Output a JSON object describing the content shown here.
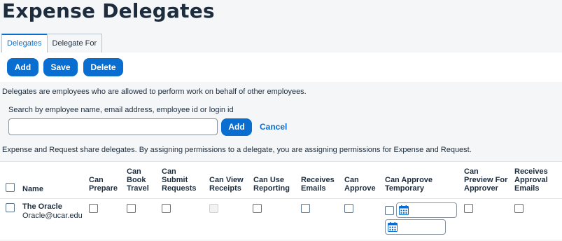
{
  "page": {
    "title": "Expense Delegates"
  },
  "tabs": [
    {
      "label": "Delegates",
      "active": true
    },
    {
      "label": "Delegate For",
      "active": false
    }
  ],
  "toolbar": {
    "add_label": "Add",
    "save_label": "Save",
    "delete_label": "Delete"
  },
  "info_text": "Delegates are employees who are allowed to perform work on behalf of other employees.",
  "search": {
    "label": "Search by employee name, email address, employee id or login id",
    "value": "",
    "add_label": "Add",
    "cancel_label": "Cancel"
  },
  "share_note": "Expense and Request share delegates. By assigning permissions to a delegate, you are assigning permissions for Expense and Request.",
  "table": {
    "headers": {
      "name": "Name",
      "can_prepare": [
        "Can",
        "Prepare"
      ],
      "can_book_travel": [
        "Can",
        "Book",
        "Travel"
      ],
      "can_submit_requests": [
        "Can",
        "Submit",
        "Requests"
      ],
      "can_view_receipts": [
        "Can View",
        "Receipts"
      ],
      "can_use_reporting": [
        "Can Use",
        "Reporting"
      ],
      "receives_emails": [
        "Receives",
        "Emails"
      ],
      "can_approve": [
        "Can",
        "Approve"
      ],
      "can_approve_temporary": [
        "Can Approve",
        "Temporary"
      ],
      "can_preview_for_approver": [
        "Can",
        "Preview For",
        "Approver"
      ],
      "receives_approval_emails": [
        "Receives",
        "Approval",
        "Emails"
      ]
    },
    "rows": [
      {
        "name": "The Oracle",
        "email": "Oracle@ucar.edu",
        "can_prepare": false,
        "can_book_travel": false,
        "can_submit_requests": false,
        "can_view_receipts": false,
        "can_view_receipts_disabled": true,
        "can_use_reporting": false,
        "receives_emails": false,
        "can_approve": false,
        "can_approve_temporary": false,
        "approve_temp_start": "",
        "approve_temp_end": "",
        "can_preview_for_approver": false,
        "receives_approval_emails": false
      }
    ]
  },
  "colors": {
    "accent": "#0a6ed1",
    "text": "#1d2d3e",
    "page_bg": "#f5f6f7"
  },
  "icons": {
    "date_picker": "calendar-icon"
  }
}
